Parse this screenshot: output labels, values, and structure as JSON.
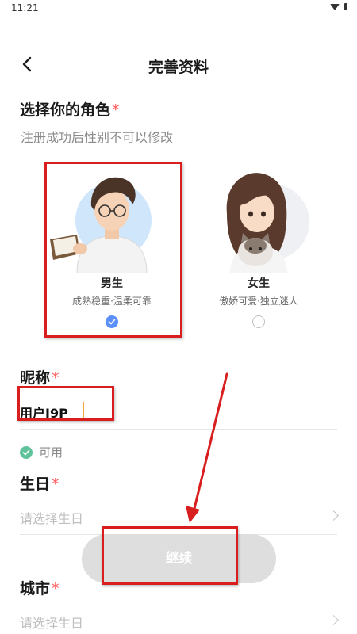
{
  "status_bar": {
    "time": "11:21"
  },
  "header": {
    "title": "完善资料"
  },
  "role": {
    "heading": "选择你的角色",
    "required_mark": "*",
    "subtitle": "注册成功后性别不可以修改",
    "options": [
      {
        "label": "男生",
        "desc": "成熟稳重·温柔可靠",
        "selected": true
      },
      {
        "label": "女生",
        "desc": "傲娇可爱·独立迷人",
        "selected": false
      }
    ]
  },
  "nickname": {
    "label": "昵称",
    "required_mark": "*",
    "value": "用户J9P",
    "status": "可用"
  },
  "birthday": {
    "label": "生日",
    "required_mark": "*",
    "placeholder": "请选择生日"
  },
  "continue_button": {
    "label": "继续"
  },
  "city": {
    "label": "城市",
    "required_mark": "*",
    "placeholder": "请选择生日"
  },
  "colors": {
    "accent": "#5b8ff9",
    "required": "#ff5a5a",
    "available": "#5fc29a",
    "annotation": "#d81e1e",
    "button_disabled": "#dedede"
  }
}
